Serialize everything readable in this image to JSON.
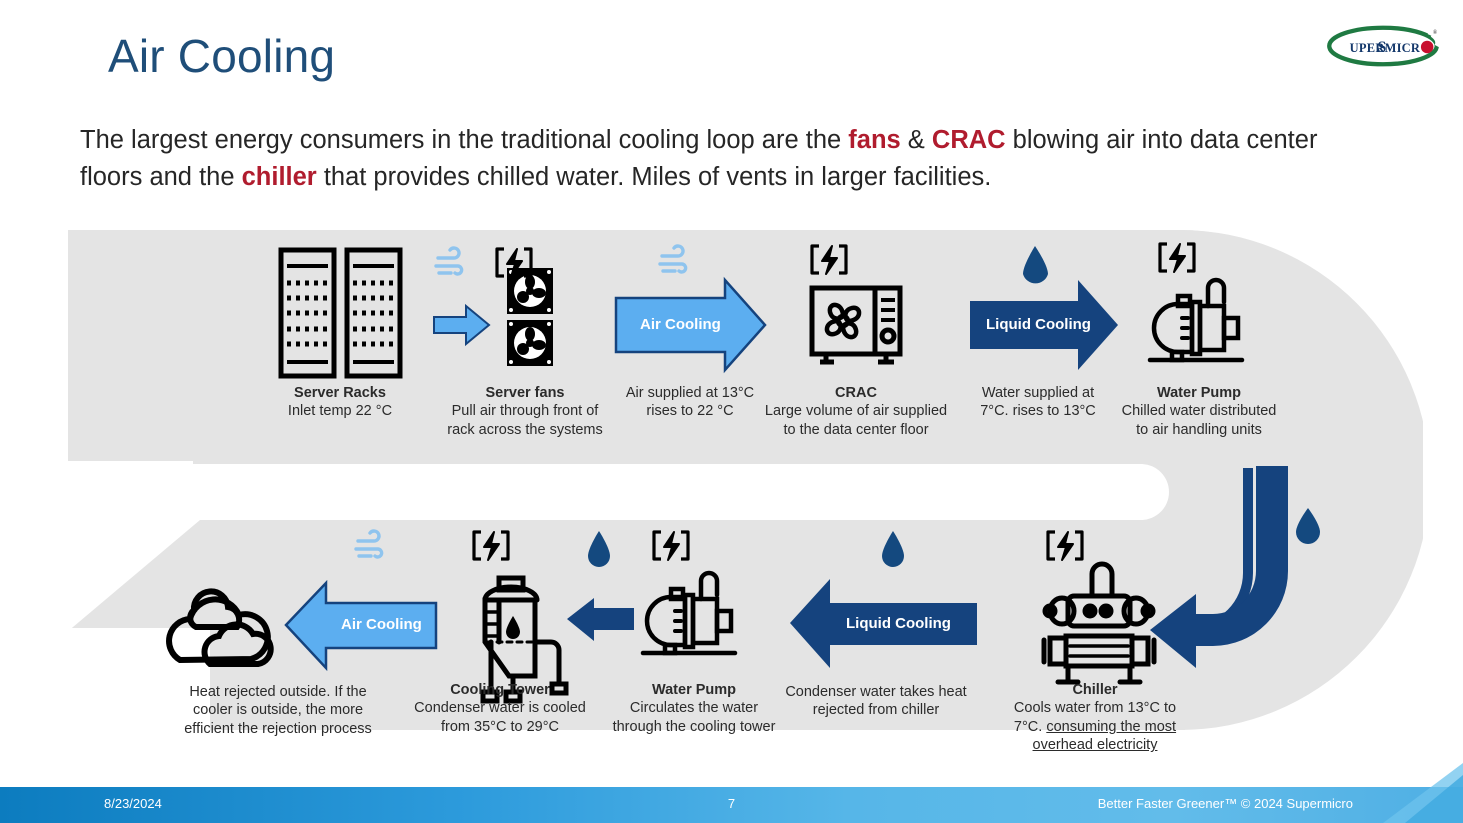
{
  "slide": {
    "title": "Air Cooling",
    "subtitle_parts": [
      {
        "t": "The largest energy consumers in the traditional cooling loop are the ",
        "hl": false
      },
      {
        "t": "fans",
        "hl": true
      },
      {
        "t": " & ",
        "hl": false
      },
      {
        "t": "CRAC",
        "hl": true
      },
      {
        "t": " blowing air into data center floors and the ",
        "hl": false
      },
      {
        "t": "chiller",
        "hl": true
      },
      {
        "t": " that provides chilled water. Miles of vents in larger facilities.",
        "hl": false
      }
    ],
    "subtitle_plain": "The largest energy consumers in the traditional cooling loop are the fans & CRAC blowing air into data center floors and the chiller that provides chilled water. Miles of vents in larger facilities.",
    "logo_text": "SUPERMICRO",
    "logo_registered": "®"
  },
  "colors": {
    "title_blue": "#1F4E79",
    "accent_red": "#B01C2E",
    "band_gray": "#E4E4E4",
    "light_blue_arrow": "#5CAEF0",
    "dark_blue_arrow": "#15437E",
    "icon_wind_blue": "#8FC4EE",
    "drop_blue": "#14497F",
    "footer_blue": "#2D9BDC"
  },
  "top_row": [
    {
      "id": "server-racks",
      "icon": "server-racks-icon",
      "badges": [],
      "title": "Server Racks",
      "lines": [
        "Inlet temp 22 °C"
      ]
    },
    {
      "id": "server-fans",
      "icon": "server-fans-icon",
      "badges": [
        "wind-icon",
        "power-icon"
      ],
      "title": "Server fans",
      "lines": [
        "Pull air through front of",
        "rack across the systems"
      ]
    },
    {
      "id": "air-supplied",
      "icon": "air-cooling-arrow-right",
      "badges": [
        "wind-icon"
      ],
      "title": "",
      "lines": [
        "Air supplied at 13°C",
        "rises to 22 °C"
      ]
    },
    {
      "id": "crac",
      "icon": "crac-icon",
      "badges": [
        "power-icon"
      ],
      "title": "CRAC",
      "lines": [
        "Large volume of air supplied",
        "to the data center floor"
      ]
    },
    {
      "id": "water-supplied",
      "icon": "liquid-cooling-arrow-right",
      "badges": [
        "drop-icon"
      ],
      "title": "",
      "lines": [
        "Water supplied at",
        "7°C. rises to 13°C"
      ]
    },
    {
      "id": "water-pump-top",
      "icon": "water-pump-icon",
      "badges": [
        "power-icon"
      ],
      "title": "Water Pump",
      "lines": [
        "Chilled water distributed",
        "to air handling units"
      ]
    }
  ],
  "bottom_row": [
    {
      "id": "heat-rejected",
      "icon": "clouds-icon",
      "badges": [],
      "title": "",
      "lines": [
        "Heat rejected outside. If the",
        "cooler is outside, the more",
        "efficient the rejection process"
      ]
    },
    {
      "id": "air-cooling-left",
      "icon": "air-cooling-arrow-left",
      "badges": [
        "wind-icon"
      ],
      "title": "",
      "lines": []
    },
    {
      "id": "cooling-tower",
      "icon": "cooling-tower-icon",
      "badges": [
        "power-icon"
      ],
      "title": "Cooling Tower",
      "lines": [
        "Condenser water is cooled",
        "from 35°C to 29°C"
      ]
    },
    {
      "id": "water-pump-bottom",
      "icon": "water-pump-icon",
      "badges": [
        "power-icon",
        "drop-icon"
      ],
      "title": "Water Pump",
      "lines": [
        "Circulates the water",
        "through the cooling tower"
      ]
    },
    {
      "id": "condenser-water",
      "icon": "liquid-cooling-arrow-left",
      "badges": [
        "drop-icon"
      ],
      "title": "",
      "lines": [
        "Condenser water takes heat",
        "rejected from chiller"
      ]
    },
    {
      "id": "chiller",
      "icon": "chiller-icon",
      "badges": [
        "power-icon"
      ],
      "title": "Chiller",
      "lines": [
        "Cools water from 13°C to",
        "7°C. consuming the most",
        "overhead electricity"
      ],
      "underlined_from_line": 1,
      "underlined_text": "consuming the most overhead electricity"
    }
  ],
  "arrow_labels": {
    "air_cooling_top": "Air Cooling",
    "liquid_cooling_top": "Liquid Cooling",
    "air_cooling_bottom": "Air Cooling",
    "liquid_cooling_bottom": "Liquid Cooling"
  },
  "footer": {
    "date": "8/23/2024",
    "page_number": "7",
    "tagline": "Better Faster Greener™  © 2024 Supermicro"
  }
}
